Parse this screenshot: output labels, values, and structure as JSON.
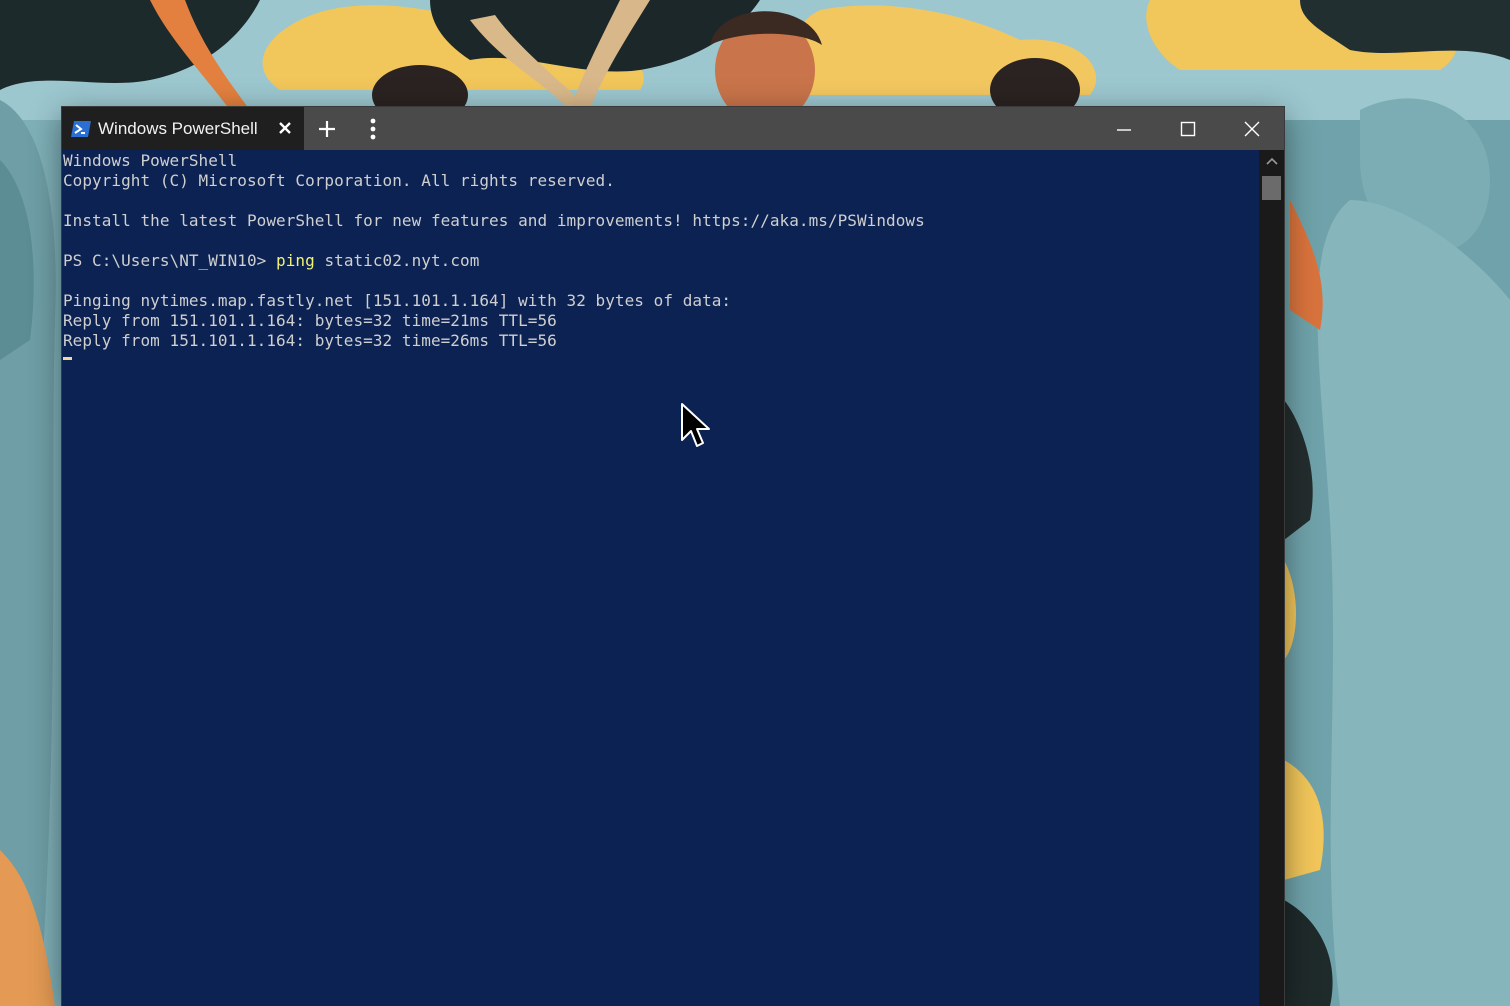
{
  "window": {
    "tab_title": "Windows PowerShell",
    "tab_icon": "powershell-icon",
    "new_tab_icon": "plus-icon",
    "menu_icon": "vertical-ellipsis-icon",
    "minimize_icon": "minimize-icon",
    "maximize_icon": "maximize-icon",
    "close_icon": "close-icon"
  },
  "console": {
    "lines": [
      "Windows PowerShell",
      "Copyright (C) Microsoft Corporation. All rights reserved.",
      "",
      "Install the latest PowerShell for new features and improvements! https://aka.ms/PSWindows",
      "",
      "",
      "",
      "Pinging nytimes.map.fastly.net [151.101.1.164] with 32 bytes of data:",
      "Reply from 151.101.1.164: bytes=32 time=21ms TTL=56",
      "Reply from 151.101.1.164: bytes=32 time=26ms TTL=56"
    ],
    "prompt": "PS C:\\Users\\NT_WIN10> ",
    "command": "ping",
    "argument": " static02.nyt.com"
  },
  "colors": {
    "console_background": "#0c2252",
    "console_text": "#cfcfcf",
    "command_highlight": "#f2f270",
    "titlebar": "#4a4a4a",
    "active_tab": "#1f1f1f"
  }
}
